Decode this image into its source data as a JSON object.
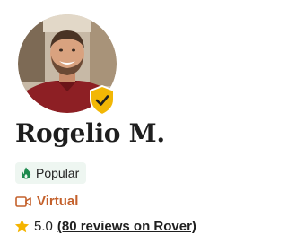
{
  "profile": {
    "name": "Rogelio M.",
    "avatar_icon": "profile-photo",
    "verified_badge_icon": "shield-check-icon",
    "badge_color": "#f2b705"
  },
  "tags": {
    "popular": {
      "label": "Popular",
      "icon": "flame-icon",
      "icon_color": "#1d8a4e",
      "background": "#eef6f1"
    },
    "virtual": {
      "label": "Virtual",
      "icon": "video-camera-icon",
      "color": "#c4602b"
    }
  },
  "rating": {
    "score": "5.0",
    "reviews_link": "(80 reviews on Rover)",
    "star_icon": "star-icon",
    "star_color": "#f5b400"
  }
}
